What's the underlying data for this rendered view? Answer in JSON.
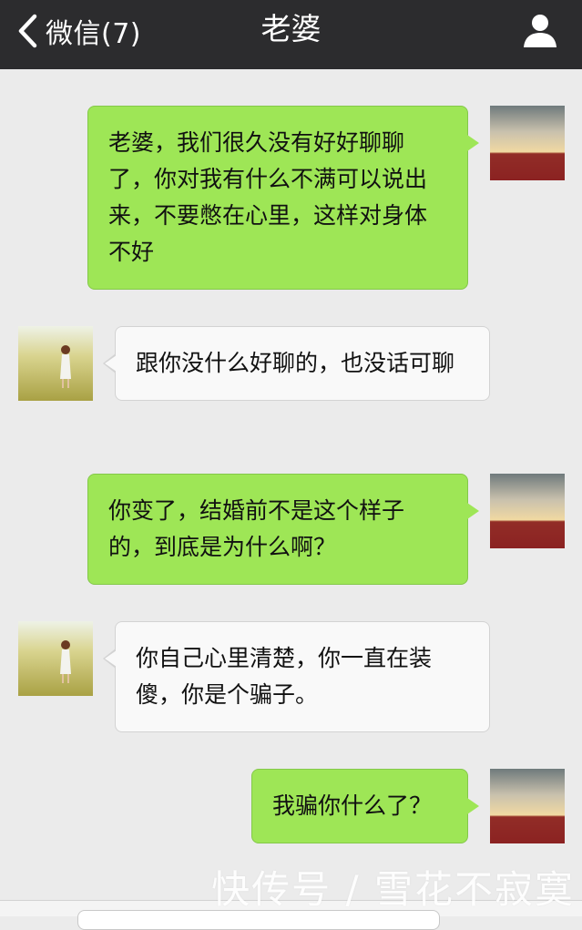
{
  "header": {
    "back_label": "微信(7)",
    "title": "老婆"
  },
  "messages": [
    {
      "sender": "me",
      "text": "老婆，我们很久没有好好聊聊了，你对我有什么不满可以说出来，不要憋在心里，这样对身体不好"
    },
    {
      "sender": "other",
      "text": "跟你没什么好聊的，也没话可聊"
    },
    {
      "sender": "me",
      "text": "你变了，结婚前不是这个样子的，到底是为什么啊？"
    },
    {
      "sender": "other",
      "text": "你自己心里清楚，你一直在装傻，你是个骗子。"
    },
    {
      "sender": "me",
      "text": "我骗你什么了？"
    }
  ],
  "watermark": "快传号 / 雪花不寂寞",
  "colors": {
    "header_bg": "#2c2c2e",
    "background": "#ebebeb",
    "my_bubble": "#9ee656",
    "other_bubble": "#f9f9f9"
  }
}
